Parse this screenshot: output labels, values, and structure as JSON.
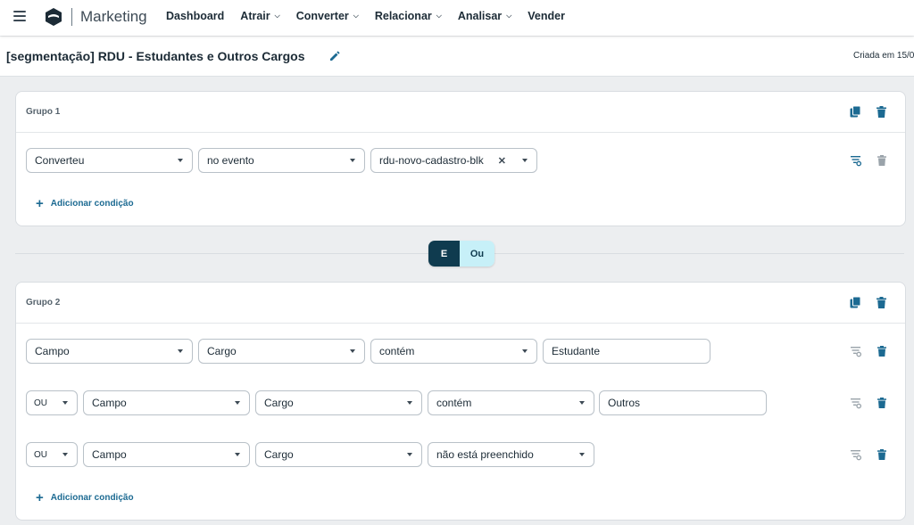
{
  "nav": {
    "app_name": "Marketing",
    "items": [
      "Dashboard",
      "Atrair",
      "Converter",
      "Relacionar",
      "Analisar",
      "Vender"
    ]
  },
  "page": {
    "title": "[segmentação] RDU - Estudantes e Outros Cargos",
    "created": "Criada em 15/0"
  },
  "group1": {
    "title": "Grupo 1",
    "row1": {
      "field": "Converteu",
      "operator": "no evento",
      "value": "rdu-novo-cadastro-blk"
    },
    "add_condition": "Adicionar condição"
  },
  "toggle": {
    "and_label": "E",
    "or_label": "Ou",
    "active": "E"
  },
  "group2": {
    "title": "Grupo 2",
    "row1": {
      "field": "Campo",
      "attribute": "Cargo",
      "operator": "contém",
      "value": "Estudante"
    },
    "row2": {
      "connector": "OU",
      "field": "Campo",
      "attribute": "Cargo",
      "operator": "contém",
      "value": "Outros"
    },
    "row3": {
      "connector": "OU",
      "field": "Campo",
      "attribute": "Cargo",
      "operator": "não está preenchido"
    },
    "add_condition": "Adicionar condição"
  },
  "colors": {
    "accent": "#1c6a92",
    "dark": "#0f3b4f",
    "toggle_off": "#c7f0f8"
  },
  "icons": [
    "menu-icon",
    "logo-icon",
    "pencil-icon",
    "copy-icon",
    "trash-icon",
    "filter-settings-icon",
    "close-icon",
    "chevron-down-icon",
    "plus-icon"
  ]
}
